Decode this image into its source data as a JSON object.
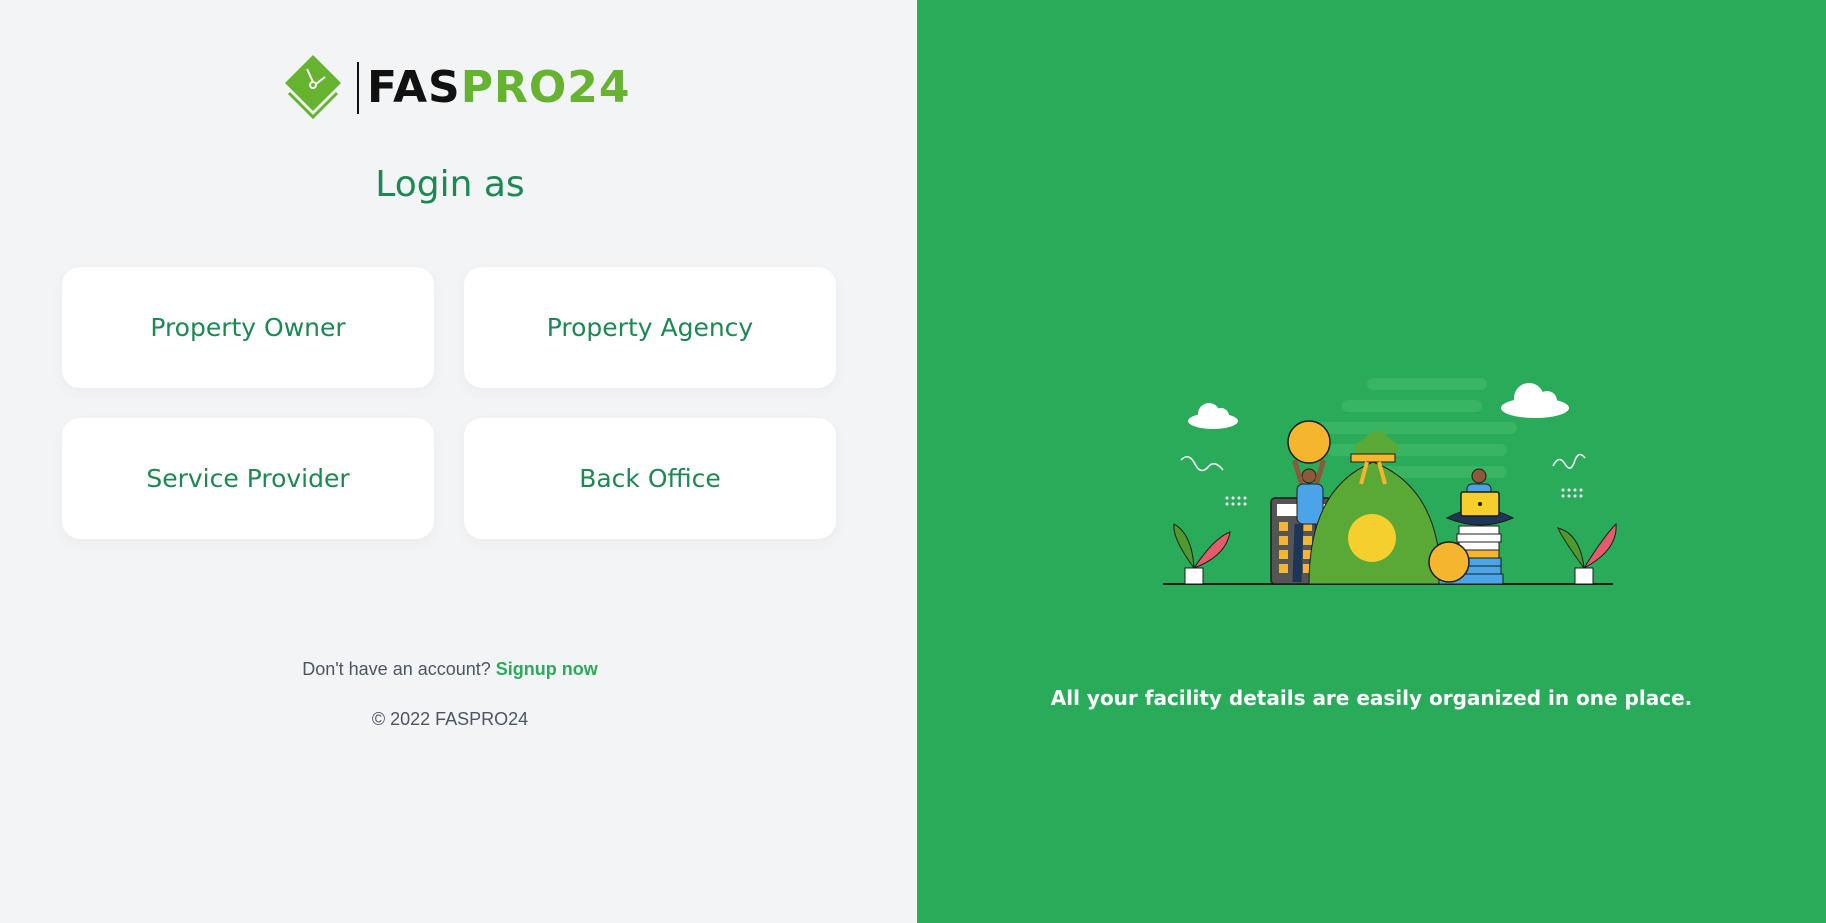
{
  "brand": {
    "name_part1": "FAS",
    "name_part2": "PRO24",
    "colors": {
      "dark": "#111111",
      "green": "#65b32e"
    }
  },
  "login": {
    "title": "Login as",
    "roles": [
      {
        "label": "Property Owner"
      },
      {
        "label": "Property Agency"
      },
      {
        "label": "Service Provider"
      },
      {
        "label": "Back Office"
      }
    ]
  },
  "footer": {
    "signup_prompt": "Don't have an account?",
    "signup_link": "Signup now",
    "copyright": "© 2022 FASPRO24"
  },
  "promo": {
    "tagline": "All your facility details are easily organized in one place.",
    "background_color": "#29ab59"
  },
  "theme": {
    "accent": "#1a8a52",
    "left_background": "#f3f4f6"
  }
}
